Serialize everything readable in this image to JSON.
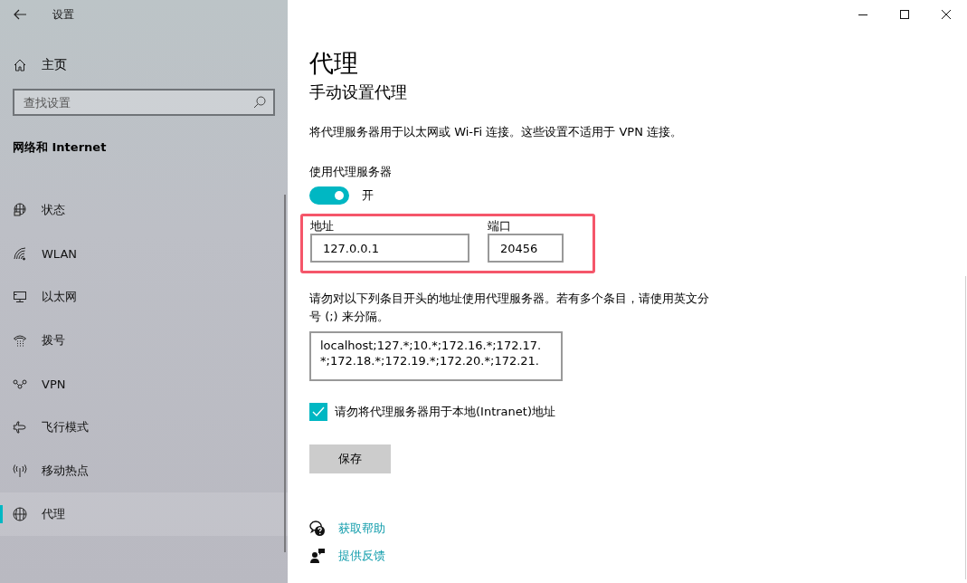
{
  "window": {
    "title": "设置"
  },
  "sidebar": {
    "home": "主页",
    "search": {
      "placeholder": "查找设置"
    },
    "section": "网络和 Internet",
    "items": [
      {
        "kind": "status",
        "label": "状态",
        "selected": false
      },
      {
        "kind": "wlan",
        "label": "WLAN",
        "selected": false
      },
      {
        "kind": "ethernet",
        "label": "以太网",
        "selected": false
      },
      {
        "kind": "dialup",
        "label": "拨号",
        "selected": false
      },
      {
        "kind": "vpn",
        "label": "VPN",
        "selected": false
      },
      {
        "kind": "airplane",
        "label": "飞行模式",
        "selected": false
      },
      {
        "kind": "hotspot",
        "label": "移动热点",
        "selected": false
      },
      {
        "kind": "proxy",
        "label": "代理",
        "selected": true
      }
    ]
  },
  "page": {
    "title": "代理",
    "subtitle": "手动设置代理",
    "description": "将代理服务器用于以太网或 Wi-Fi 连接。这些设置不适用于 VPN 连接。",
    "use_proxy": {
      "label": "使用代理服务器",
      "on": true,
      "state_text": "开"
    },
    "address": {
      "label": "地址",
      "value": "127.0.0.1"
    },
    "port": {
      "label": "端口",
      "value": "20456"
    },
    "exceptions": {
      "label": "请勿对以下列条目开头的地址使用代理服务器。若有多个条目，请使用英文分号 (;) 来分隔。",
      "value": "localhost;127.*;10.*;172.16.*;172.17.*;172.18.*;172.19.*;172.20.*;172.21."
    },
    "bypass_local": {
      "label": "请勿将代理服务器用于本地(Intranet)地址",
      "checked": true
    },
    "save_button": "保存",
    "links": [
      {
        "kind": "help",
        "label": "获取帮助"
      },
      {
        "kind": "feedback",
        "label": "提供反馈"
      }
    ]
  }
}
